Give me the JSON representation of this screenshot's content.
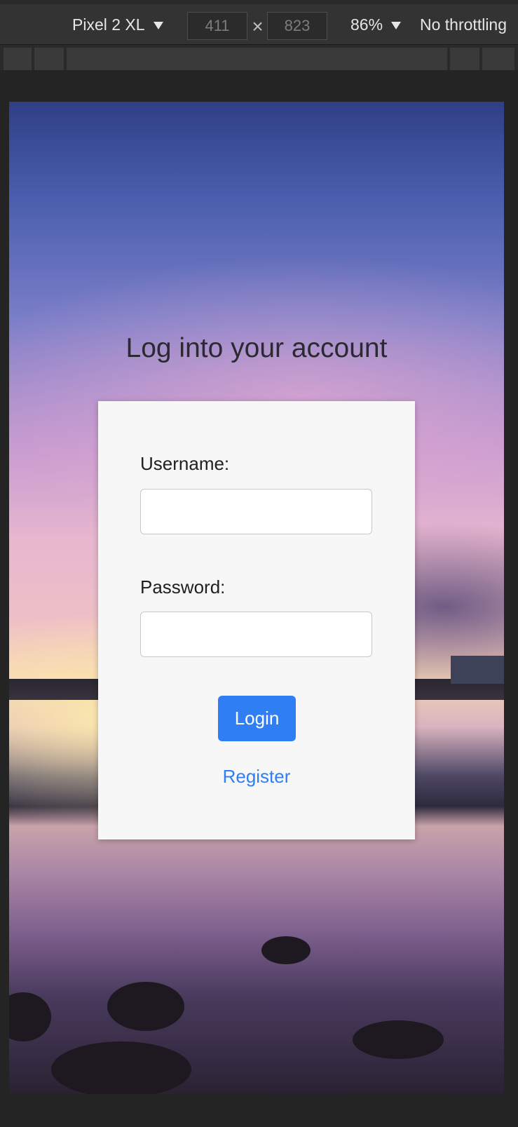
{
  "devtools": {
    "device_name": "Pixel 2 XL",
    "width_value": "411",
    "height_value": "823",
    "dimension_separator": "×",
    "zoom": "86%",
    "throttling": "No throttling"
  },
  "page": {
    "title": "Log into your account"
  },
  "form": {
    "username_label": "Username:",
    "username_value": "",
    "password_label": "Password:",
    "password_value": "",
    "login_label": "Login",
    "register_label": "Register"
  },
  "colors": {
    "primary": "#2f7ef4",
    "card_background": "#f7f7f7",
    "toolbar_background": "#333333"
  }
}
